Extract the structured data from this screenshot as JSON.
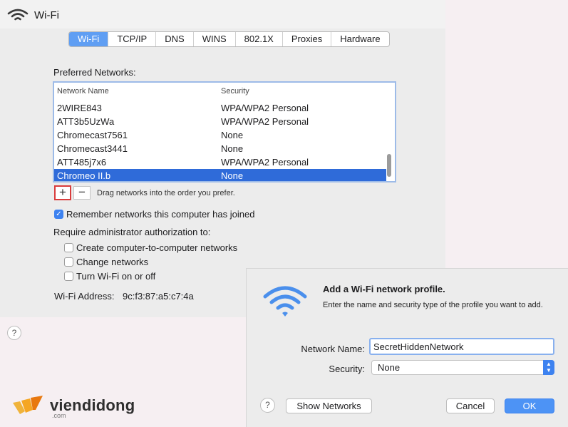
{
  "prefs": {
    "title": "Wi-Fi",
    "tabs": [
      {
        "label": "Wi-Fi",
        "active": true
      },
      {
        "label": "TCP/IP"
      },
      {
        "label": "DNS"
      },
      {
        "label": "WINS"
      },
      {
        "label": "802.1X"
      },
      {
        "label": "Proxies"
      },
      {
        "label": "Hardware"
      }
    ],
    "preferred_label": "Preferred Networks:",
    "table": {
      "columns": [
        "Network Name",
        "Security"
      ],
      "rows": [
        {
          "name": "2WIRE843",
          "security": "WPA/WPA2 Personal"
        },
        {
          "name": "ATT3b5UzWa",
          "security": "WPA/WPA2 Personal"
        },
        {
          "name": "Chromecast7561",
          "security": "None"
        },
        {
          "name": "Chromecast3441",
          "security": "None"
        },
        {
          "name": "ATT485j7x6",
          "security": "WPA/WPA2 Personal"
        },
        {
          "name": "Chromeo II.b",
          "security": "None",
          "selected": true
        }
      ]
    },
    "add_symbol": "+",
    "remove_symbol": "−",
    "drag_hint": "Drag networks into the order you prefer.",
    "remember_label": "Remember networks this computer has joined",
    "remember_checked": true,
    "admin_label": "Require administrator authorization to:",
    "admin_options": [
      {
        "label": "Create computer-to-computer networks",
        "checked": false
      },
      {
        "label": "Change networks",
        "checked": false
      },
      {
        "label": "Turn Wi-Fi on or off",
        "checked": false
      }
    ],
    "address_label": "Wi-Fi Address:",
    "address_value": "9c:f3:87:a5:c7:4a",
    "help_symbol": "?"
  },
  "logo": {
    "text": "viendidong",
    "sub": ".com"
  },
  "dialog": {
    "title": "Add a Wi-Fi network profile.",
    "description": "Enter the name and security type of the profile you want to add.",
    "network_name_label": "Network Name:",
    "network_name_value": "SecretHiddenNetwork",
    "security_label": "Security:",
    "security_value": "None",
    "help_symbol": "?",
    "show_networks_label": "Show Networks",
    "cancel_label": "Cancel",
    "ok_label": "OK"
  },
  "colors": {
    "accent": "#3d82f0",
    "selection": "#2f6bd9",
    "highlight_box": "#d93c3c",
    "logo_orange": "#f5a623"
  },
  "icons": [
    "wifi-icon",
    "wifi-large-icon",
    "plus-icon",
    "minus-icon",
    "help-icon",
    "checkmark-icon",
    "updown-arrows-icon",
    "logo-mark-icon"
  ]
}
